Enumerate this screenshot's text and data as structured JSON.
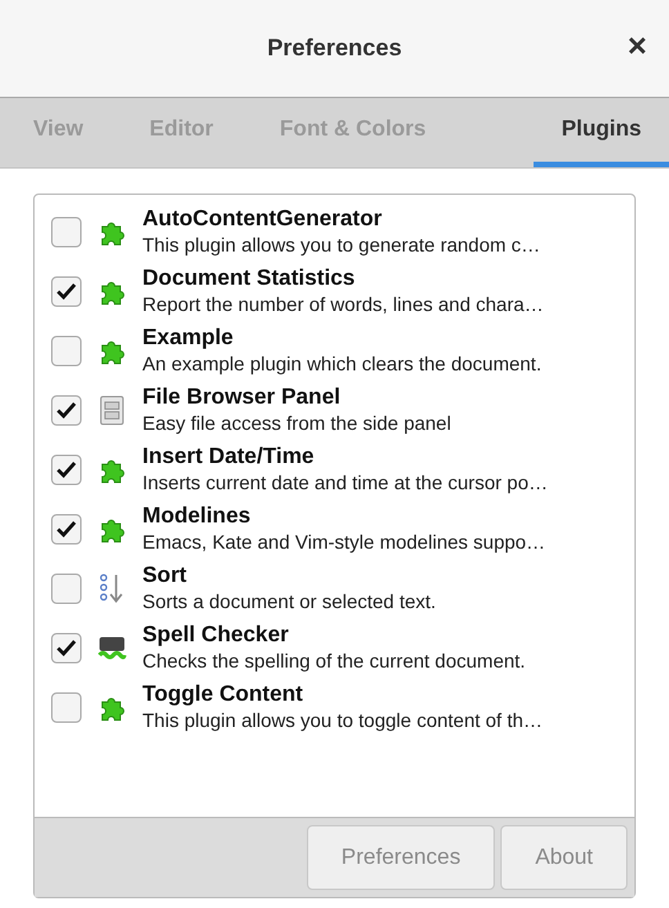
{
  "window": {
    "title": "Preferences",
    "close": "×"
  },
  "tabs": [
    {
      "label": "View",
      "selected": false
    },
    {
      "label": "Editor",
      "selected": false
    },
    {
      "label": "Font & Colors",
      "selected": false
    },
    {
      "label": "Plugins",
      "selected": true
    }
  ],
  "plugins": [
    {
      "name": "AutoContentGenerator",
      "description": "This plugin allows you to generate random c…",
      "checked": false,
      "kind": "puzzle"
    },
    {
      "name": "Document Statistics",
      "description": "Report the number of words, lines and chara…",
      "checked": true,
      "kind": "puzzle"
    },
    {
      "name": "Example",
      "description": "An example plugin which clears the document.",
      "checked": false,
      "kind": "puzzle"
    },
    {
      "name": "File Browser Panel",
      "description": "Easy file access from the side panel",
      "checked": true,
      "kind": "cabinet"
    },
    {
      "name": "Insert Date/Time",
      "description": "Inserts current date and time at the cursor po…",
      "checked": true,
      "kind": "puzzle"
    },
    {
      "name": "Modelines",
      "description": "Emacs, Kate and Vim-style modelines suppo…",
      "checked": true,
      "kind": "puzzle"
    },
    {
      "name": "Sort",
      "description": "Sorts a document or selected text.",
      "checked": false,
      "kind": "sort"
    },
    {
      "name": "Spell Checker",
      "description": "Checks the spelling of the current document.",
      "checked": true,
      "kind": "spell"
    },
    {
      "name": "Toggle Content",
      "description": "This plugin allows you to toggle content of th…",
      "checked": false,
      "kind": "puzzle"
    }
  ],
  "buttons": [
    {
      "label": "Preferences",
      "disabled": true
    },
    {
      "label": "About",
      "disabled": true
    }
  ]
}
